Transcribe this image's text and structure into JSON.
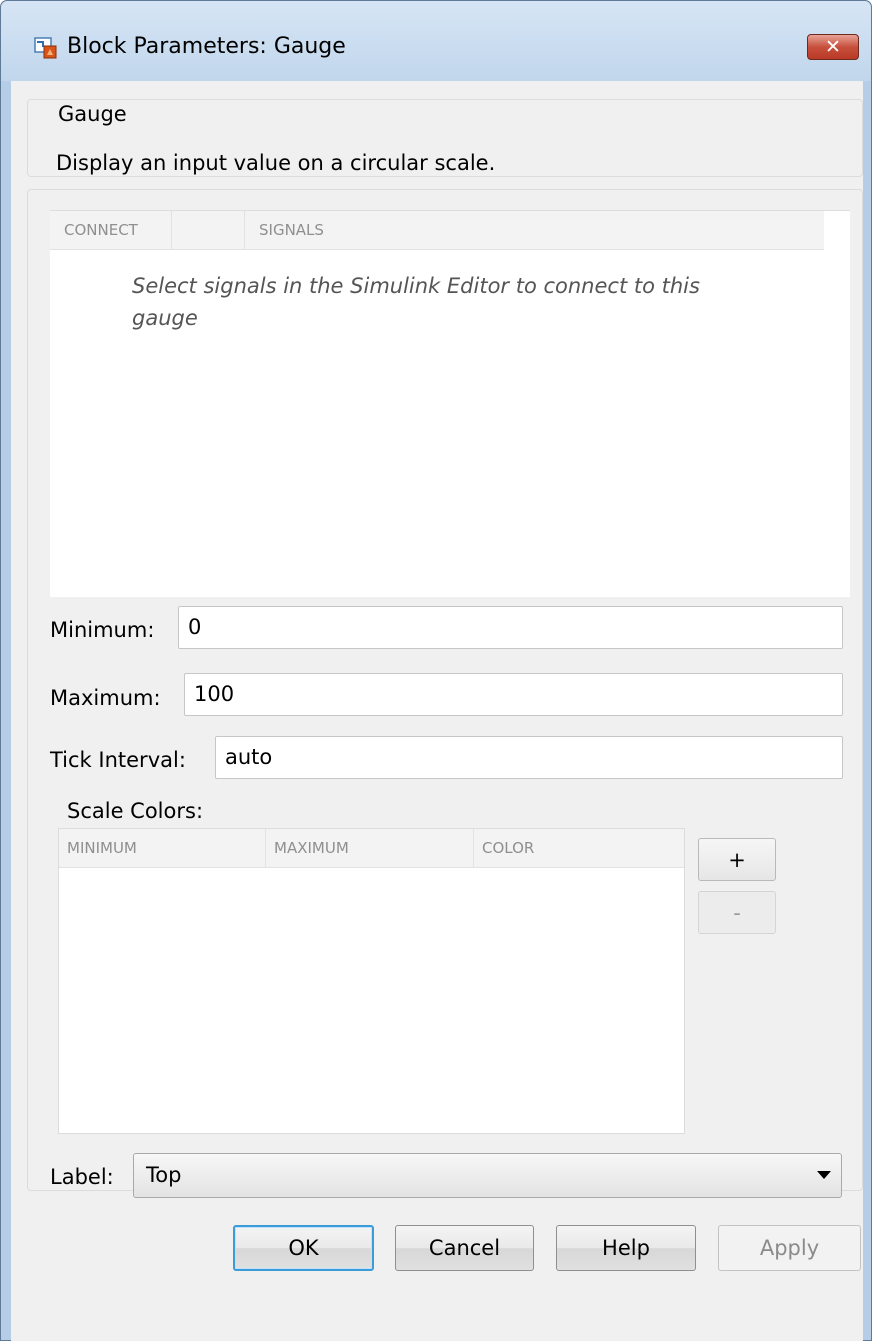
{
  "window": {
    "title": "Block Parameters: Gauge"
  },
  "group": {
    "title": "Gauge",
    "description": "Display an input value on a circular scale."
  },
  "signals_table": {
    "columns": [
      "CONNECT",
      "",
      "SIGNALS"
    ],
    "empty_message": "Select signals in the Simulink Editor to connect to this gauge"
  },
  "fields": {
    "minimum": {
      "label": "Minimum:",
      "value": "0"
    },
    "maximum": {
      "label": "Maximum:",
      "value": "100"
    },
    "tick_interval": {
      "label": "Tick Interval:",
      "value": "auto"
    }
  },
  "scale_colors": {
    "label": "Scale Colors:",
    "columns": [
      "MINIMUM",
      "MAXIMUM",
      "COLOR"
    ],
    "add_label": "+",
    "remove_label": "-"
  },
  "label_select": {
    "label": "Label:",
    "value": "Top"
  },
  "buttons": {
    "ok": "OK",
    "cancel": "Cancel",
    "help": "Help",
    "apply": "Apply"
  },
  "colors": {
    "titlebar": "#c1d6ec",
    "close_button": "#c7503c",
    "default_button_border": "#3c9cd8"
  }
}
